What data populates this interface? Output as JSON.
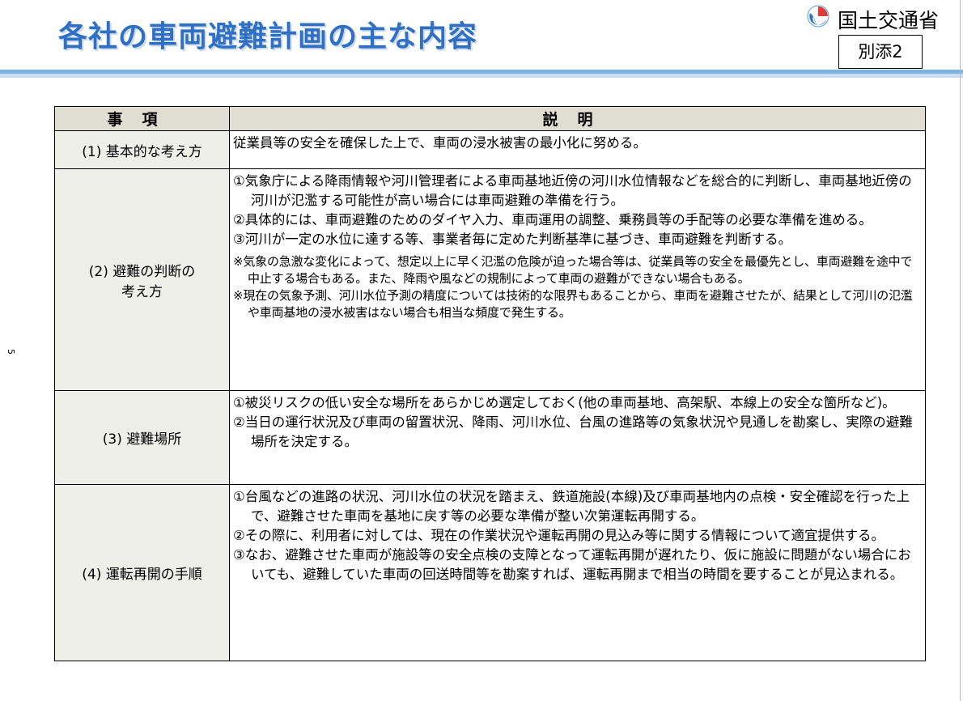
{
  "header": {
    "title": "各社の車両避難計画の主な内容",
    "ministry": "国土交通省",
    "attachment_label": "別添2"
  },
  "page_number": "5",
  "table": {
    "col_headers": [
      "事項",
      "説明"
    ],
    "rows": [
      {
        "key": "(1) 基本的な考え方",
        "items": [
          "従業員等の安全を確保した上で、車両の浸水被害の最小化に努める。"
        ],
        "notes": []
      },
      {
        "key": "(2) 避難の判断の考え方",
        "items": [
          "①気象庁による降雨情報や河川管理者による車両基地近傍の河川水位情報などを総合的に判断し、車両基地近傍の河川が氾濫する可能性が高い場合には車両避難の準備を行う。",
          "②具体的には、車両避難のためのダイヤ入力、車両運用の調整、乗務員等の手配等の必要な準備を進める。",
          "③河川が一定の水位に達する等、事業者毎に定めた判断基準に基づき、車両避難を判断する。"
        ],
        "notes": [
          "※気象の急激な変化によって、想定以上に早く氾濫の危険が迫った場合等は、従業員等の安全を最優先とし、車両避難を途中で中止する場合もある。また、降雨や風などの規制によって車両の避難ができない場合もある。",
          "※現在の気象予測、河川水位予測の精度については技術的な限界もあることから、車両を避難させたが、結果として河川の氾濫や車両基地の浸水被害はない場合も相当な頻度で発生する。"
        ]
      },
      {
        "key": "(3) 避難場所",
        "items": [
          "①被災リスクの低い安全な場所をあらかじめ選定しておく(他の車両基地、高架駅、本線上の安全な箇所など)。",
          "②当日の運行状況及び車両の留置状況、降雨、河川水位、台風の進路等の気象状況や見通しを勘案し、実際の避難場所を決定する。"
        ],
        "notes": []
      },
      {
        "key": "(4) 運転再開の手順",
        "items": [
          "①台風などの進路の状況、河川水位の状況を踏まえ、鉄道施設(本線)及び車両基地内の点検・安全確認を行った上で、避難させた車両を基地に戻す等の必要な準備が整い次第運転再開する。",
          "②その際に、利用者に対しては、現在の作業状況や運転再開の見込み等に関する情報について適宜提供する。",
          "③なお、避難させた車両が施設等の安全点検の支障となって運転再開が遅れたり、仮に施設に問題がない場合においても、避難していた車両の回送時間等を勘案すれば、運転再開まで相当の時間を要することが見込まれる。"
        ],
        "notes": []
      }
    ]
  },
  "colors": {
    "title": "#2f6fc4",
    "header_bar": "#7fb0e0",
    "table_header_bg": "#deded2",
    "key_cell_bg": "#efefea"
  }
}
